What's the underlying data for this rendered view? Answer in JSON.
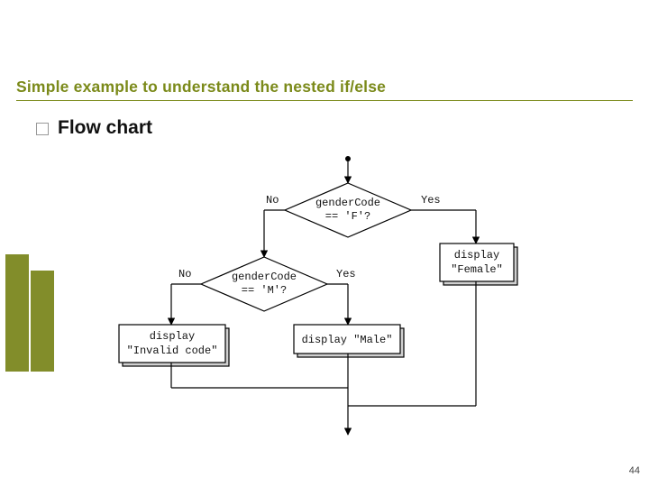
{
  "slide": {
    "title": "Simple example to understand the nested if/else",
    "subtitle": "Flow chart",
    "page_number": "44"
  },
  "chart_data": {
    "type": "flowchart",
    "nodes": [
      {
        "id": "d1",
        "kind": "decision",
        "text": [
          "genderCode",
          "== 'F'?"
        ]
      },
      {
        "id": "d2",
        "kind": "decision",
        "text": [
          "genderCode",
          "== 'M'?"
        ]
      },
      {
        "id": "p1",
        "kind": "process",
        "text": [
          "display",
          "\"Female\""
        ]
      },
      {
        "id": "p2",
        "kind": "process",
        "text": [
          "display \"Male\""
        ]
      },
      {
        "id": "p3",
        "kind": "process",
        "text": [
          "display",
          "\"Invalid code\""
        ]
      }
    ],
    "edges": [
      {
        "from": "start",
        "to": "d1"
      },
      {
        "from": "d1",
        "to": "p1",
        "label": "Yes"
      },
      {
        "from": "d1",
        "to": "d2",
        "label": "No"
      },
      {
        "from": "d2",
        "to": "p2",
        "label": "Yes"
      },
      {
        "from": "d2",
        "to": "p3",
        "label": "No"
      },
      {
        "from": "p1",
        "to": "end"
      },
      {
        "from": "p2",
        "to": "end"
      },
      {
        "from": "p3",
        "to": "end"
      }
    ],
    "labels": {
      "yes": "Yes",
      "no": "No"
    }
  }
}
